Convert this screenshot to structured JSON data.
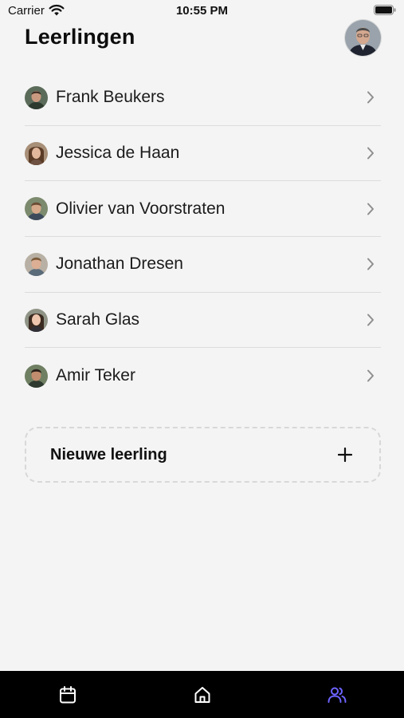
{
  "status_bar": {
    "carrier": "Carrier",
    "time": "10:55 PM",
    "wifi_icon": "wifi-icon",
    "battery_icon": "battery-icon"
  },
  "header": {
    "title": "Leerlingen",
    "profile_avatar": "profile-avatar"
  },
  "students": [
    {
      "name": "Frank Beukers",
      "icon": "chevron-right-icon"
    },
    {
      "name": "Jessica de Haan",
      "icon": "chevron-right-icon"
    },
    {
      "name": "Olivier van Voorstraten",
      "icon": "chevron-right-icon"
    },
    {
      "name": "Jonathan Dresen",
      "icon": "chevron-right-icon"
    },
    {
      "name": "Sarah Glas",
      "icon": "chevron-right-icon"
    },
    {
      "name": "Amir Teker",
      "icon": "chevron-right-icon"
    }
  ],
  "new_student": {
    "label": "Nieuwe leerling",
    "icon": "plus-icon"
  },
  "tab_bar": {
    "tabs": [
      {
        "icon": "calendar-icon",
        "active": false
      },
      {
        "icon": "home-icon",
        "active": false
      },
      {
        "icon": "users-icon",
        "active": true
      }
    ],
    "active_color": "#6c63ff",
    "inactive_color": "#ffffff"
  }
}
